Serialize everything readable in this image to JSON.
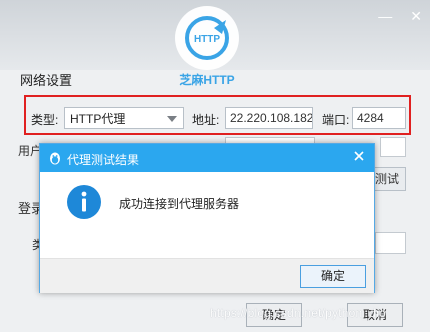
{
  "window": {
    "logo_text": "芝麻HTTP",
    "section_title": "网络设置"
  },
  "proxy_row": {
    "type_label": "类型:",
    "type_value": "HTTP代理",
    "address_label": "地址:",
    "address_value": "22.220.108.182",
    "port_label": "端口:",
    "port_value": "4284"
  },
  "background_partial": {
    "user_label_fragment": "用户",
    "test_button_fragment": "测试",
    "login_label_fragment": "登录",
    "type_fragment": "类"
  },
  "buttons": {
    "confirm": "确定",
    "cancel": "取消"
  },
  "watermark": "https://blog.csdn.net/python_dio",
  "dialog": {
    "title": "代理测试结果",
    "message": "成功连接到代理服务器",
    "ok_label": "确定"
  },
  "colors": {
    "accent_blue": "#2ba7ef",
    "highlight_red": "#e02020"
  }
}
